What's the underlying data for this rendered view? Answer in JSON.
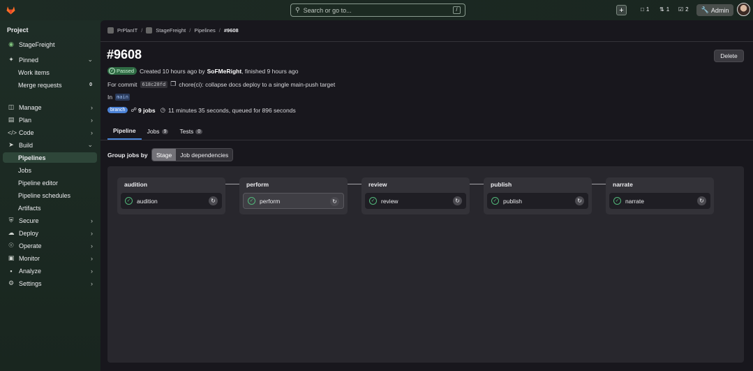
{
  "search": {
    "placeholder": "Search or go to...",
    "shortcut": "/"
  },
  "topbar": {
    "counts": [
      "1",
      "1",
      "2"
    ],
    "admin_label": "Admin"
  },
  "sidebar": {
    "heading": "Project",
    "project": "StageFreight",
    "pinned": "Pinned",
    "pinned_items": [
      {
        "label": "Work items"
      },
      {
        "label": "Merge requests",
        "badge": "0"
      }
    ],
    "sections": [
      {
        "label": "Manage"
      },
      {
        "label": "Plan"
      },
      {
        "label": "Code"
      },
      {
        "label": "Build"
      }
    ],
    "build_items": [
      "Pipelines",
      "Jobs",
      "Pipeline editor",
      "Pipeline schedules",
      "Artifacts"
    ],
    "sections2": [
      {
        "label": "Secure"
      },
      {
        "label": "Deploy"
      },
      {
        "label": "Operate"
      },
      {
        "label": "Monitor"
      },
      {
        "label": "Analyze"
      },
      {
        "label": "Settings"
      }
    ]
  },
  "breadcrumb": [
    "PrPlanIT",
    "StageFreight",
    "Pipelines",
    "#9608"
  ],
  "pipeline": {
    "title": "#9608",
    "delete_label": "Delete",
    "status": "Passed",
    "created_text": "Created 10 hours ago by",
    "author": "SoFMeRight",
    "finished_text": ", finished 9 hours ago",
    "for_commit": "For commit",
    "commit_sha": "618c28fd",
    "commit_msg": "chore(ci): collapse docs deploy to a single main-push target",
    "in_label": "In",
    "branch_name": "main",
    "branch_badge": "branch",
    "jobs_count": "9 jobs",
    "duration": "11 minutes 35 seconds, queued for 896 seconds"
  },
  "tabs": [
    {
      "label": "Pipeline"
    },
    {
      "label": "Jobs",
      "count": "9"
    },
    {
      "label": "Tests",
      "count": "0"
    }
  ],
  "group_by": {
    "label": "Group jobs by",
    "options": [
      "Stage",
      "Job dependencies"
    ]
  },
  "stages": [
    {
      "name": "audition",
      "job": "audition"
    },
    {
      "name": "perform",
      "job": "perform"
    },
    {
      "name": "review",
      "job": "review"
    },
    {
      "name": "publish",
      "job": "publish"
    },
    {
      "name": "narrate",
      "job": "narrate"
    }
  ]
}
